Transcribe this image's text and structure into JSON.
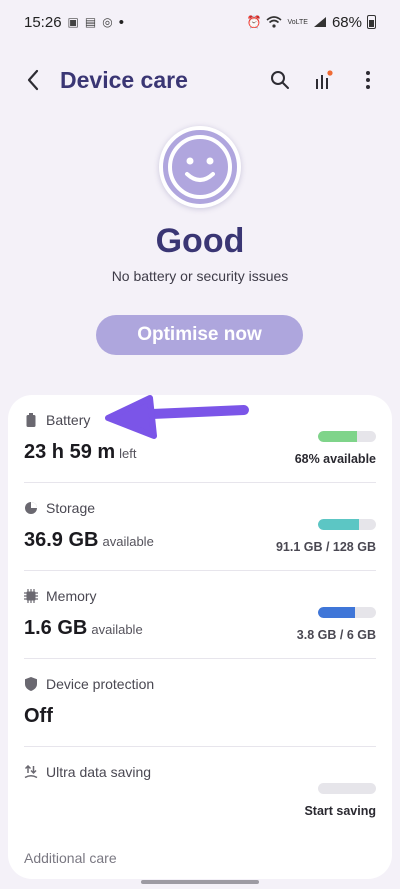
{
  "status_bar": {
    "time": "15:26",
    "dot": "•",
    "battery_percent": "68%",
    "volte": "VoLTE"
  },
  "header": {
    "title": "Device care"
  },
  "hero": {
    "status": "Good",
    "subtitle": "No battery or security issues",
    "optimise_label": "Optimise now"
  },
  "items": [
    {
      "label": "Battery",
      "value": "23 h 59 m",
      "suffix": "left",
      "right": "68% available",
      "fill": 0.68,
      "color": "#7fd48a"
    },
    {
      "label": "Storage",
      "value": "36.9 GB",
      "suffix": "available",
      "right": "91.1 GB / 128 GB",
      "fill": 0.71,
      "color": "#5cc6c4"
    },
    {
      "label": "Memory",
      "value": "1.6 GB",
      "suffix": "available",
      "right": "3.8 GB / 6 GB",
      "fill": 0.63,
      "color": "#3f76d8"
    },
    {
      "label": "Device protection",
      "value": "Off"
    },
    {
      "label": "Ultra data saving",
      "right": "Start saving",
      "fill": 0
    }
  ],
  "footer": {
    "additional_care": "Additional care"
  },
  "colors": {
    "accent": "#3a3674",
    "button": "#aea6dd",
    "arrow": "#7b55e8"
  }
}
